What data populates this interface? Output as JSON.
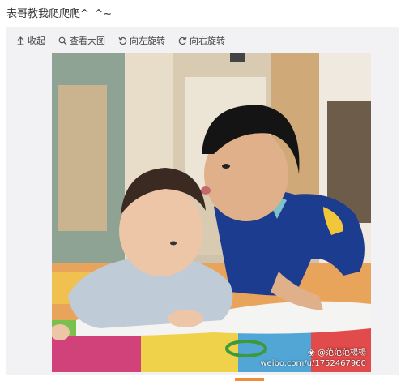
{
  "post": {
    "text": "表哥教我爬爬爬^_^~"
  },
  "toolbar": {
    "collapse_label": "收起",
    "view_large_label": "查看大图",
    "rotate_left_label": "向左旋转",
    "rotate_right_label": "向右旋转"
  },
  "photo": {
    "watermark_user": "@范范范楊楊",
    "watermark_url": "weibo.com/u/1752467960"
  },
  "colors": {
    "panel_bg": "#f2f2f5",
    "accent": "#f08f3b",
    "text": "#333333"
  }
}
